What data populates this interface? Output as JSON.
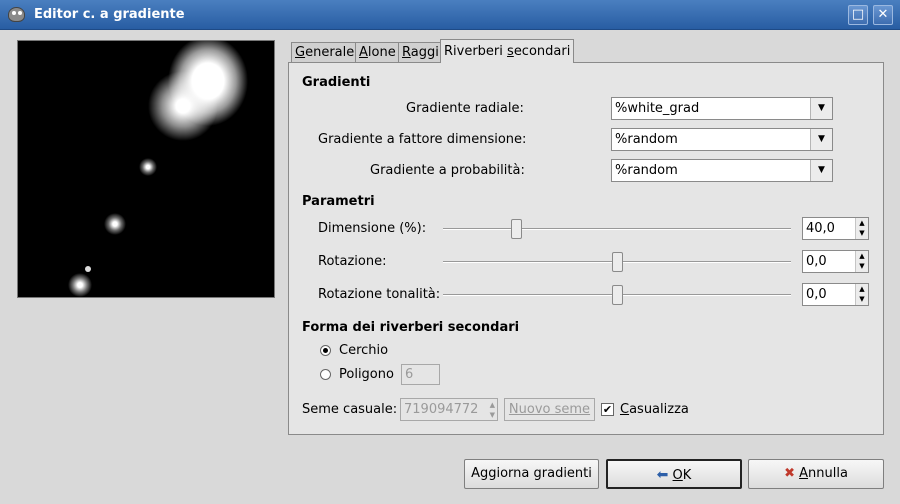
{
  "window": {
    "title": "Editor c. a gradiente",
    "maximize": "□",
    "close": "✕"
  },
  "tabs": [
    {
      "label": "Generale",
      "mnemonic": "G",
      "rest": "enerale"
    },
    {
      "label": "Alone",
      "mnemonic": "A",
      "rest": "lone"
    },
    {
      "label": "Raggi",
      "mnemonic": "R",
      "rest": "aggi"
    },
    {
      "label": "Riverberi secondari",
      "pre": "Riverberi ",
      "mnemonic": "s",
      "rest": "econdari"
    }
  ],
  "gradients": {
    "heading": "Gradienti",
    "radial": {
      "label": "Gradiente radiale:",
      "value": "%white_grad"
    },
    "size_factor": {
      "label": "Gradiente a fattore dimensione:",
      "value": "%random"
    },
    "probability": {
      "label": "Gradiente a probabilità:",
      "value": "%random"
    }
  },
  "params": {
    "heading": "Parametri",
    "size": {
      "label": "Dimensione (%):",
      "value": "40,0",
      "level": 0.21
    },
    "rotation": {
      "label": "Rotazione:",
      "value": "0,0",
      "level": 0.5
    },
    "hue": {
      "label": "Rotazione tonalità:",
      "value": "0,0",
      "level": 0.5
    }
  },
  "shape": {
    "heading": "Forma dei riverberi secondari",
    "circle": "Cerchio",
    "polygon": "Poligono",
    "polygon_value": "6",
    "selected": "circle"
  },
  "seed": {
    "label": "Seme casuale:",
    "value": "719094772",
    "new_seed": "Nuovo seme",
    "randomize": "Casualizza",
    "randomize_mnemonic": "C",
    "randomize_rest": "asualizza",
    "randomize_checked": "✔"
  },
  "buttons": {
    "refresh": "Aggiorna gradienti",
    "ok": "OK",
    "ok_mnemonic": "O",
    "ok_rest": "K",
    "cancel": "Annulla",
    "cancel_mnemonic": "A",
    "cancel_rest": "nnulla"
  },
  "arrows": {
    "down": "▼",
    "up": "▲"
  },
  "colors": {
    "titlebar": "#3567ad",
    "preview_bg": "#000000"
  }
}
